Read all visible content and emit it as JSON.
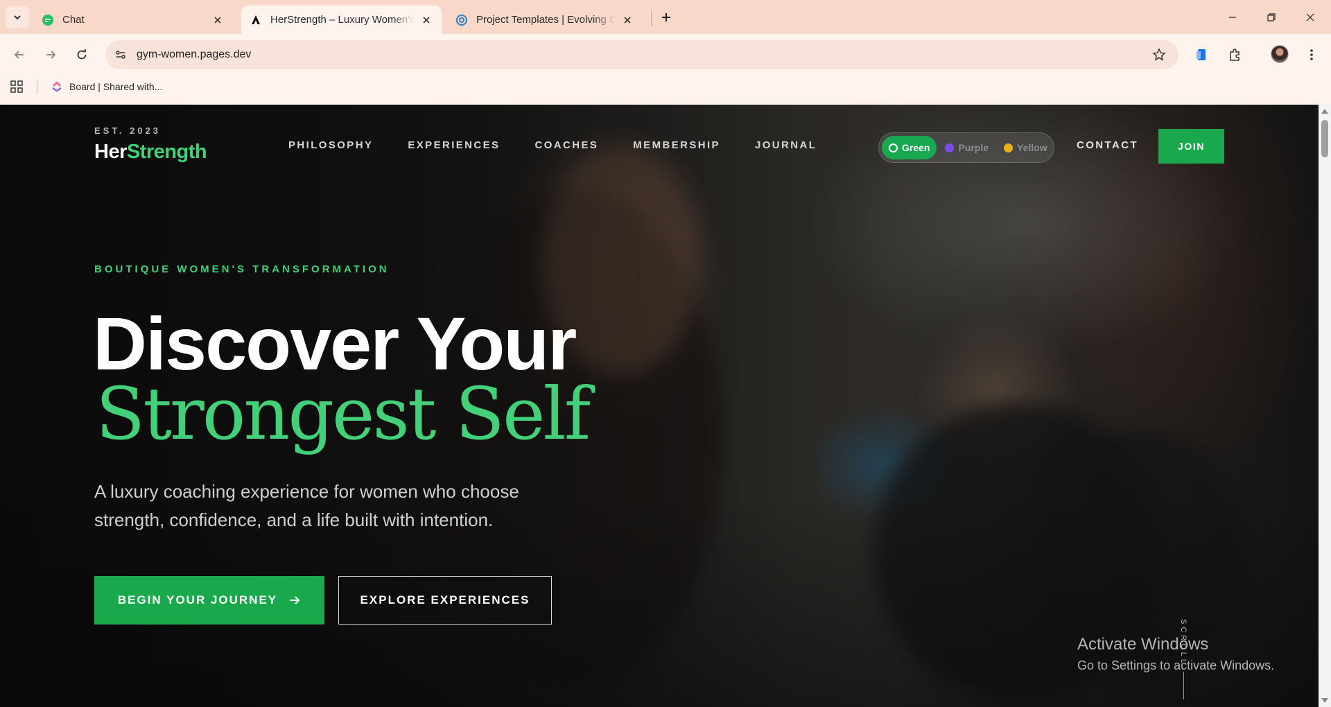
{
  "browser": {
    "tabs": [
      {
        "label": "Chat",
        "icon": "chat-app-icon",
        "active": false
      },
      {
        "label": "HerStrength – Luxury Women's",
        "icon": "site-logo-icon",
        "active": true
      },
      {
        "label": "Project Templates | Evolving Cyb",
        "icon": "project-site-icon",
        "active": false
      }
    ],
    "url": "gym-women.pages.dev",
    "bookmark": {
      "label": "Board | Shared with..."
    }
  },
  "site": {
    "est": "EST. 2023",
    "logo": {
      "her": "Her",
      "strength": "Strength"
    },
    "nav": [
      "PHILOSOPHY",
      "EXPERIENCES",
      "COACHES",
      "MEMBERSHIP",
      "JOURNAL"
    ],
    "theme_options": [
      {
        "label": "Green",
        "color": "#18a850",
        "active": true
      },
      {
        "label": "Purple",
        "color": "#7a4df0",
        "active": false
      },
      {
        "label": "Yellow",
        "color": "#e8b11a",
        "active": false
      }
    ],
    "contact": "CONTACT",
    "join": "JOIN",
    "hero": {
      "eyebrow": "BOUTIQUE WOMEN'S TRANSFORMATION",
      "title_line1": "Discover Your",
      "title_line2": "Strongest Self",
      "subtitle": "A luxury coaching experience for women who choose strength, confidence, and a life built with intention.",
      "primary_cta": "BEGIN YOUR JOURNEY",
      "secondary_cta": "EXPLORE EXPERIENCES",
      "scroll_hint": "SCROLL"
    },
    "accent_color": "#1aa84d"
  },
  "os_overlay": {
    "title": "Activate Windows",
    "subtitle": "Go to Settings to activate Windows."
  }
}
